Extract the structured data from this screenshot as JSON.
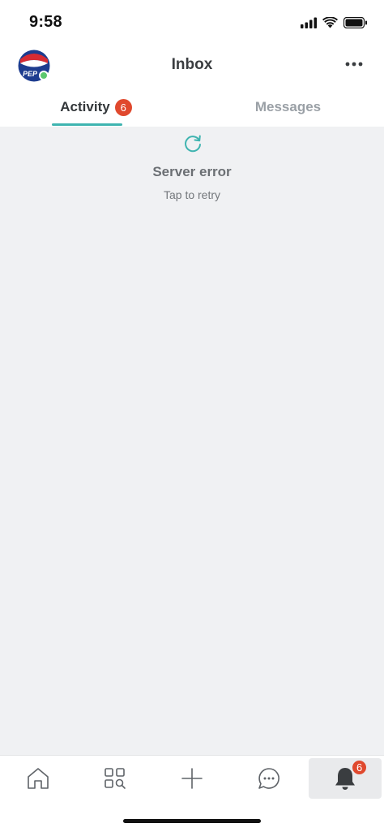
{
  "status_bar": {
    "time": "9:58",
    "icons": [
      "cellular-signal-icon",
      "wifi-icon",
      "battery-icon"
    ]
  },
  "header": {
    "title": "Inbox",
    "avatar_icon": "pepsi-logo",
    "avatar_text": "PEP",
    "more_icon": "ellipsis-icon"
  },
  "tabs": [
    {
      "label": "Activity",
      "badge": "6",
      "active": true
    },
    {
      "label": "Messages",
      "active": false
    }
  ],
  "error": {
    "icon": "retry-icon",
    "title": "Server error",
    "subtitle": "Tap to retry"
  },
  "tabbar": {
    "items": [
      {
        "icon": "home-icon"
      },
      {
        "icon": "search-apps-icon"
      },
      {
        "icon": "plus-icon"
      },
      {
        "icon": "chat-icon"
      },
      {
        "icon": "bell-icon",
        "badge": "6",
        "active": true
      }
    ]
  },
  "colors": {
    "accent": "#3fb4b0",
    "badge": "#e0492e",
    "content_bg": "#f0f1f3",
    "online_dot": "#5cc86e"
  }
}
